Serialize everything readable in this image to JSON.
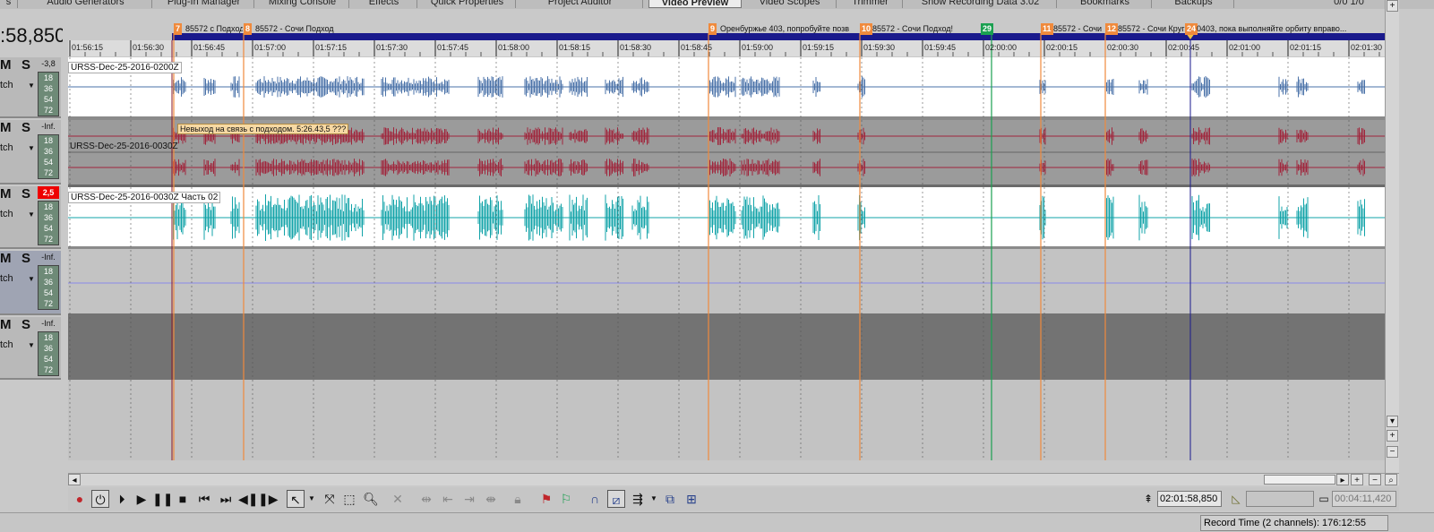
{
  "tabs": [
    {
      "label": "s"
    },
    {
      "label": "Audio Generators"
    },
    {
      "label": "Plug-In Manager"
    },
    {
      "label": "Mixing Console"
    },
    {
      "label": "Effects"
    },
    {
      "label": "Quick Properties"
    },
    {
      "label": "Project Auditor"
    },
    {
      "label": "Video Preview"
    },
    {
      "label": "Video Scopes"
    },
    {
      "label": "Trimmer"
    },
    {
      "label": "Show Recording Data 3.02"
    },
    {
      "label": "Bookmarks"
    },
    {
      "label": "Backups"
    },
    {
      "label": "0/0   1/0"
    }
  ],
  "time_display": ":58,850",
  "tracks": [
    {
      "mute": "M",
      "solo": "S",
      "volume": "-3,8",
      "mode": "tch",
      "meter": [
        "18",
        "36",
        "54",
        "72"
      ]
    },
    {
      "mute": "M",
      "solo": "S",
      "volume": "-Inf.",
      "mode": "tch",
      "meter": [
        "18",
        "36",
        "54",
        "72"
      ]
    },
    {
      "mute": "M",
      "solo": "S",
      "volume": "2,5",
      "mode": "tch",
      "meter": [
        "18",
        "36",
        "54",
        "72"
      ]
    },
    {
      "mute": "M",
      "solo": "S",
      "volume": "-Inf.",
      "mode": "tch",
      "meter": [
        "18",
        "36",
        "54",
        "72"
      ]
    },
    {
      "mute": "M",
      "solo": "S",
      "volume": "-Inf.",
      "mode": "tch",
      "meter": [
        "18",
        "36",
        "54",
        "72"
      ]
    }
  ],
  "ruler": {
    "ticks": [
      "01:56:15",
      "01:56:30",
      "01:56:45",
      "01:57:00",
      "01:57:15",
      "01:57:30",
      "01:57:45",
      "01:58:00",
      "01:58:15",
      "01:58:30",
      "01:58:45",
      "01:59:00",
      "01:59:15",
      "01:59:30",
      "01:59:45",
      "02:00:00",
      "02:00:15",
      "02:00:30",
      "02:00:45",
      "02:01:00",
      "02:01:15",
      "02:01:30"
    ]
  },
  "markers": [
    {
      "num": "7",
      "label": "85572 с Подход",
      "color": "#f08a3c"
    },
    {
      "num": "8",
      "label": "85572 - Сочи Подход",
      "color": "#f08a3c"
    },
    {
      "num": "9",
      "label": "Оренбуржье 403, попробуйте позв",
      "color": "#f08a3c"
    },
    {
      "num": "10",
      "label": "85572 - Сочи Подход!",
      "color": "#f08a3c"
    },
    {
      "num": "29",
      "label": "",
      "color": "#1aa050"
    },
    {
      "num": "11",
      "label": "85572 - Сочи",
      "color": "#f08a3c"
    },
    {
      "num": "12",
      "label": "85572 - Сочи Круг!",
      "color": "#f08a3c"
    },
    {
      "num": "24",
      "label": "0403, пока выполняйте орбиту вправо...",
      "color": "#f08a3c"
    }
  ],
  "clips": [
    {
      "name": "URSS-Dec-25-2016-0200Z",
      "color": "#4a72a8"
    },
    {
      "name": "URSS-Dec-25-2016-0030Z",
      "color": "#a0263c"
    },
    {
      "name": "URSS-Dec-25-2016-0030Z Часть 02",
      "color": "#12a3a8"
    }
  ],
  "tooltip": "Невыход на связь с подходом. 5:26.43,5  ???",
  "toolbar": {
    "cursor_time": "02:01:58,850",
    "selection": "",
    "length": "00:04:11,420"
  },
  "status": {
    "record_time": "Record Time (2 channels): 176:12:55"
  }
}
